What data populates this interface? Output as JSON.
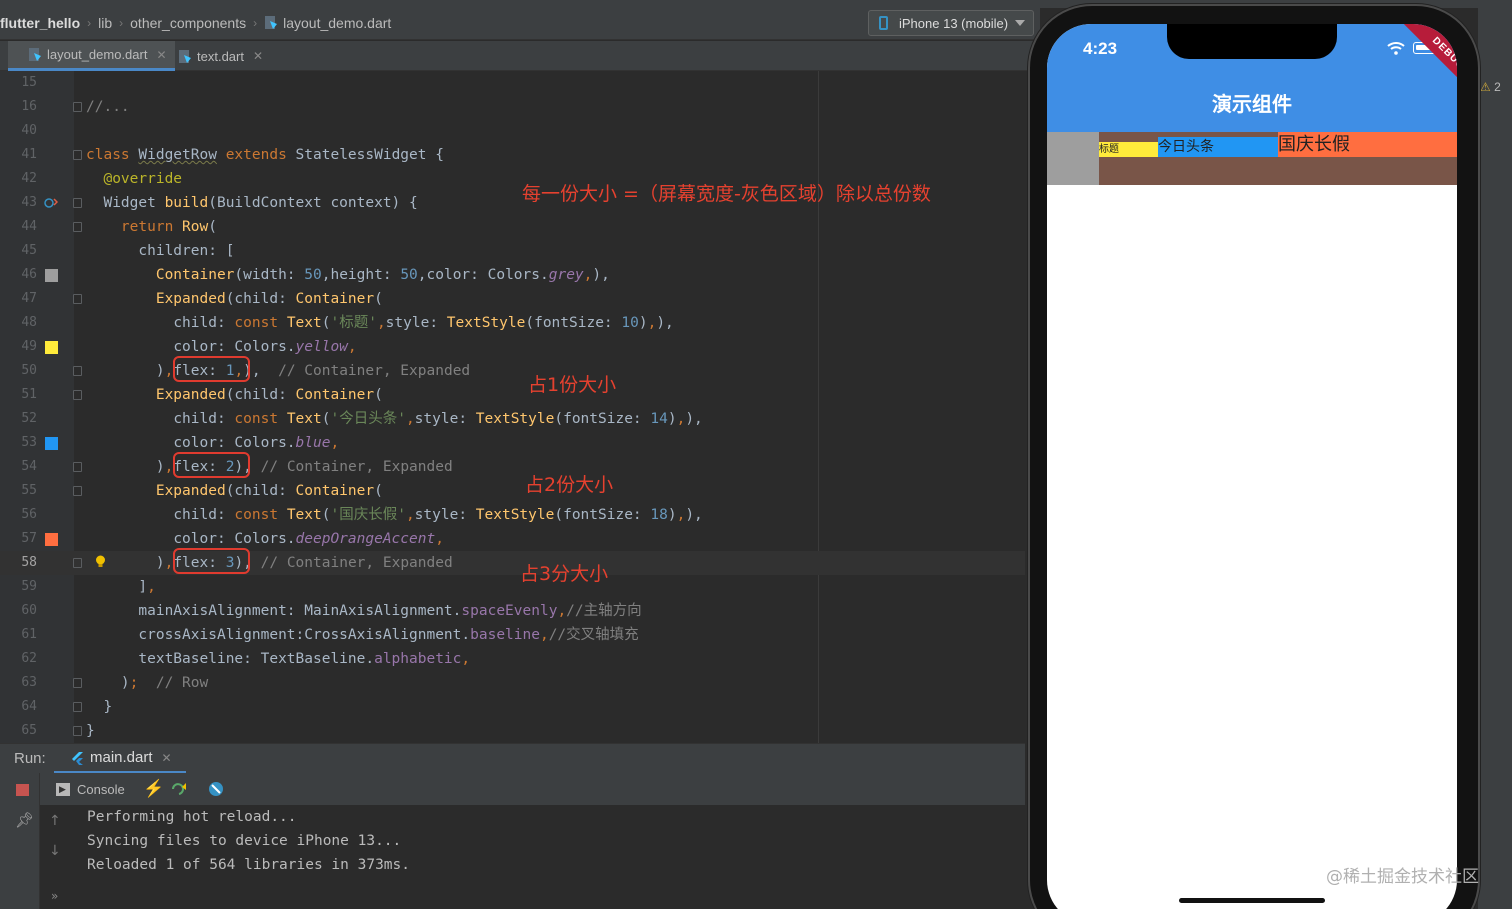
{
  "breadcrumb": [
    "flutter_hello",
    "lib",
    "other_components",
    "layout_demo.dart"
  ],
  "device_selector": "iPhone 13 (mobile)",
  "editor_tabs": [
    {
      "label": "layout_demo.dart",
      "active": true
    },
    {
      "label": "text.dart",
      "active": false
    }
  ],
  "code_lines": {
    "l15": "15",
    "l16": "16",
    "l40": "40",
    "l41": "41",
    "l42": "42",
    "l43": "43",
    "l44": "44",
    "l45": "45",
    "l46": "46",
    "l47": "47",
    "l48": "48",
    "l49": "49",
    "l50": "50",
    "l51": "51",
    "l52": "52",
    "l53": "53",
    "l54": "54",
    "l55": "55",
    "l56": "56",
    "l57": "57",
    "l58": "58",
    "l59": "59",
    "l60": "60",
    "l61": "61",
    "l62": "62",
    "l63": "63",
    "l64": "64",
    "l65": "65"
  },
  "annotations": {
    "formula": "每一份大小 =（屏幕宽度-灰色区域）除以总份数",
    "flex1": "占1份大小",
    "flex2": "占2份大小",
    "flex3": "占3分大小"
  },
  "run_panel": {
    "label": "Run:",
    "tab": "main.dart",
    "console_tab": "Console",
    "output": [
      "Performing hot reload...",
      "Syncing files to device iPhone 13...",
      "Reloaded 1 of 564 libraries in 373ms."
    ]
  },
  "warning_count": "2",
  "phone": {
    "time": "4:23",
    "app_title": "演示组件",
    "debug_banner": "DEBUG",
    "row_texts": [
      "标题",
      "今日头条",
      "国庆长假"
    ],
    "colors": {
      "appbar": "#3f8ee5",
      "grey": "#9e9e9e",
      "yellow": "#ffeb3b",
      "blue": "#2196f3",
      "orange": "#ff6e40",
      "brown": "#795548"
    },
    "flex": [
      1,
      2,
      3
    ]
  },
  "watermark": "@稀土掘金技术社区"
}
